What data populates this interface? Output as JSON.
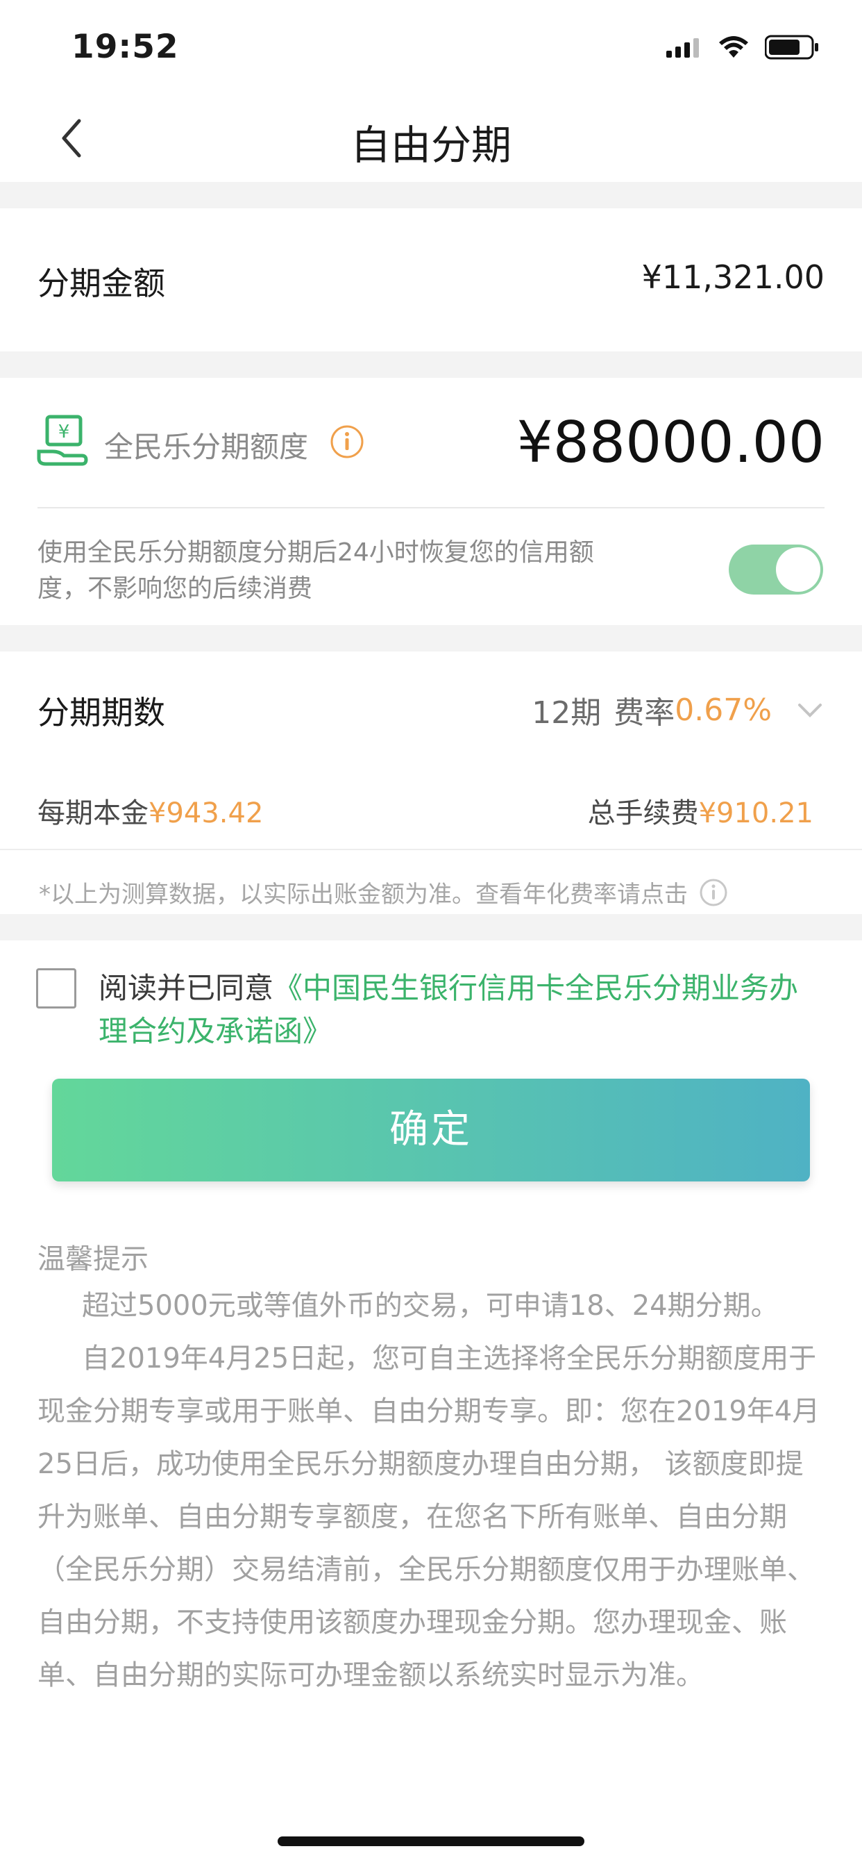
{
  "status_bar": {
    "time": "19:52"
  },
  "nav": {
    "title": "自由分期"
  },
  "amount": {
    "label": "分期金额",
    "value": "¥11,321.00"
  },
  "quota": {
    "label": "全民乐分期额度",
    "value": "¥88000.00",
    "desc": "使用全民乐分期额度分期后24小时恢复您的信用额度，不影响您的后续消费",
    "toggle_on": true
  },
  "installment": {
    "label": "分期期数",
    "periods": "12期",
    "rate_label": "费率",
    "rate_value": "0.67%",
    "principal_label": "每期本金",
    "principal_value": "¥943.42",
    "fee_label": "总手续费",
    "fee_value": "¥910.21",
    "note": "*以上为测算数据，以实际出账金额为准。查看年化费率请点击"
  },
  "agreement": {
    "prefix": "阅读并已同意",
    "link": "《中国民生银行信用卡全民乐分期业务办理合约及承诺函》",
    "checked": false
  },
  "confirm_label": "确定",
  "tips": {
    "title": "温馨提示",
    "p1": "超过5000元或等值外币的交易，可申请18、24期分期。",
    "p2": "自2019年4月25日起，您可自主选择将全民乐分期额度用于现金分期专享或用于账单、自由分期专享。即：您在2019年4月25日后，成功使用全民乐分期额度办理自由分期， 该额度即提升为账单、自由分期专享额度，在您名下所有账单、自由分期（全民乐分期）交易结清前，全民乐分期额度仅用于办理账单、自由分期，不支持使用该额度办理现金分期。您办理现金、账单、自由分期的实际可办理金额以系统实时显示为准。"
  },
  "colors": {
    "accent_green": "#3bb36b",
    "accent_orange": "#f0a04b",
    "toggle_green": "#8fd3a6"
  },
  "icons": [
    "back-chevron-icon",
    "signal-icon",
    "wifi-icon",
    "battery-icon",
    "cash-hand-icon",
    "info-icon",
    "chevron-down-icon"
  ]
}
